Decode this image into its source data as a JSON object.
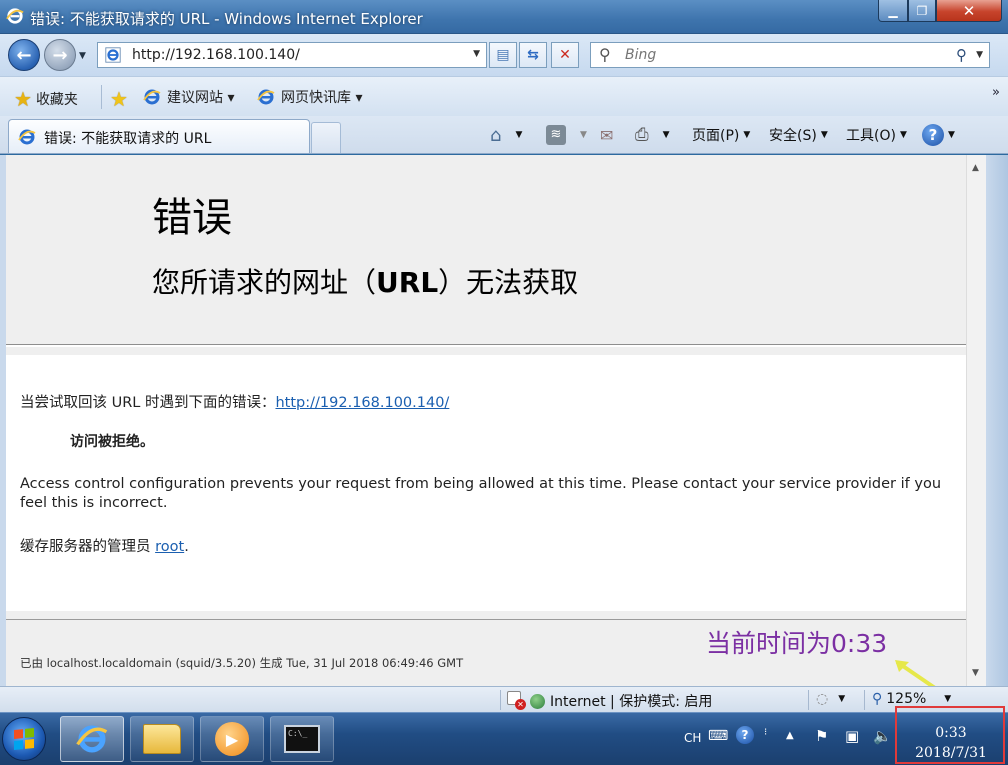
{
  "window": {
    "title": "错误: 不能获取请求的 URL - Windows Internet Explorer",
    "min": "▁",
    "max": "❐",
    "close": "✕"
  },
  "nav": {
    "url": "http://192.168.100.140/",
    "search_placeholder": "Bing"
  },
  "favorites": {
    "favorites_label": "收藏夹",
    "suggested_sites": "建议网站 ▾",
    "web_slice": "网页快讯库 ▾",
    "more": "»"
  },
  "tab": {
    "label": "错误: 不能获取请求的 URL"
  },
  "commands": {
    "page": "页面(P)",
    "safety": "安全(S)",
    "tools": "工具(O)",
    "help": "?"
  },
  "page": {
    "heading": "错误",
    "subheading_pre": "您所请求的网址（",
    "subheading_url": "URL",
    "subheading_post": "）无法获取",
    "attempt_text": "当尝试取回该  URL 时遇到下面的错误：",
    "attempt_link": "http://192.168.100.140/",
    "denied": "访问被拒绝。",
    "access_message": "Access control configuration prevents your request from being allowed at this time. Please contact your service provider if you feel this is incorrect.",
    "admin_text": "缓存服务器的管理员  ",
    "admin_link": "root",
    "admin_end": ".",
    "generated": "已由  localhost.localdomain (squid/3.5.20) 生成  Tue, 31 Jul 2018 06:49:46 GMT"
  },
  "annotation": {
    "text": "当前时间为0:33",
    "color": "#7b2fa3"
  },
  "status": {
    "zone": "Internet | 保护模式: 启用",
    "zoom": "125%"
  },
  "taskbar": {
    "lang": "CH",
    "time": "0:33",
    "date": "2018/7/31"
  }
}
